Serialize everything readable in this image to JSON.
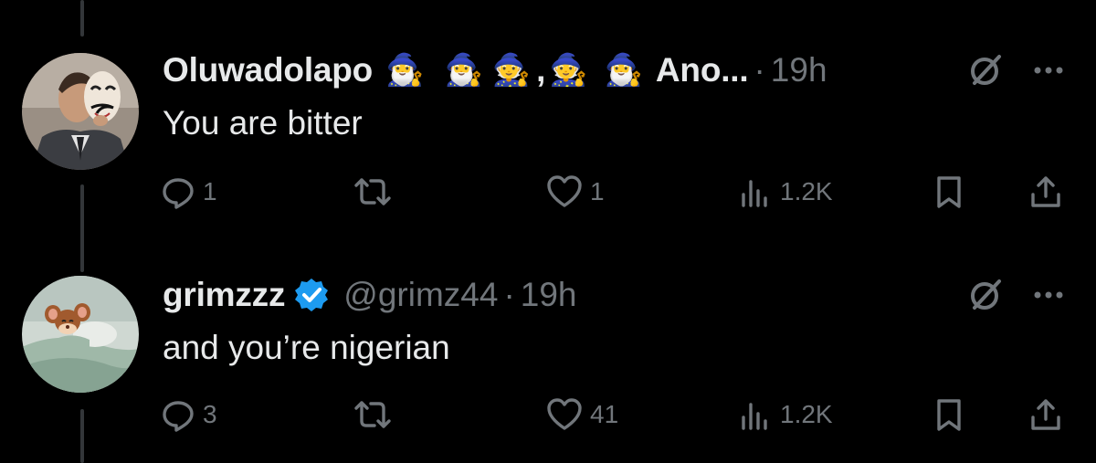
{
  "tweets": [
    {
      "name": "Oluwadolapo",
      "emoji_prefix": [
        "🧙‍♂️",
        "🧙‍♂️",
        "🧙"
      ],
      "comma": ",",
      "emoji_suffix": [
        "🧙",
        "🧙‍♂️"
      ],
      "truncated": "Ano...",
      "dot": "·",
      "time": "19h",
      "text": "You are bitter",
      "replies": "1",
      "retweets": "",
      "likes": "1",
      "views": "1.2K",
      "avatar_icon": "masked-man-avatar"
    },
    {
      "name": "grimzzz",
      "verified": true,
      "handle": "@grimz44",
      "dot": "·",
      "time": "19h",
      "text": "and you’re nigerian",
      "replies": "3",
      "retweets": "",
      "likes": "41",
      "views": "1.2K",
      "avatar_icon": "cartoon-mouse-avatar"
    }
  ],
  "colors": {
    "background": "#000000",
    "primary_text": "#e7e9ea",
    "secondary_text": "#71767b",
    "verified_blue": "#1d9bf0",
    "thread_line": "#333639"
  },
  "icons": [
    "reply-icon",
    "retweet-icon",
    "like-icon",
    "views-icon",
    "bookmark-icon",
    "share-icon",
    "grok-icon",
    "more-icon",
    "verified-badge-icon"
  ]
}
